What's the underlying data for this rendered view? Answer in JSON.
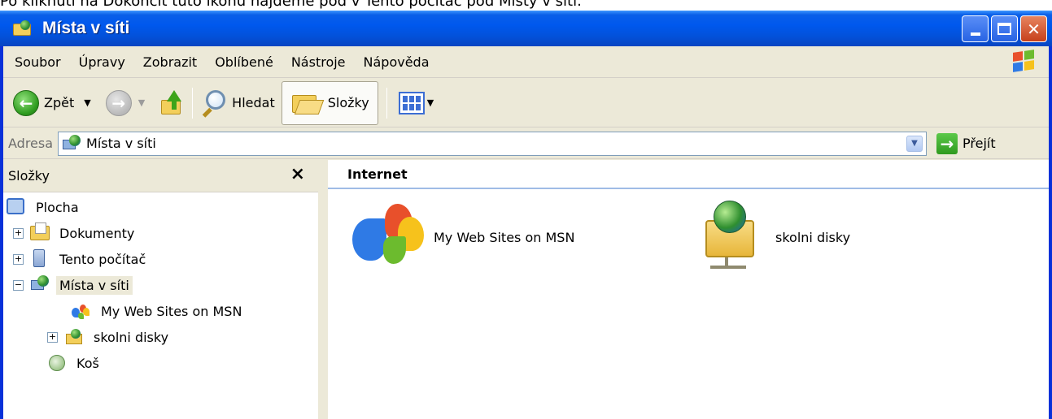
{
  "caption_text": "Po kliknutí na Dokončit tuto ikonu najdeme pod v Tento počítač pod Místy v síti.",
  "window": {
    "title": "Místa v síti",
    "icon": "network-places-icon",
    "buttons": [
      "minimize-icon",
      "maximize-icon",
      "close-icon"
    ]
  },
  "menubar": {
    "items": [
      "Soubor",
      "Úpravy",
      "Zobrazit",
      "Oblíbené",
      "Nástroje",
      "Nápověda"
    ]
  },
  "toolbar": {
    "back_label": "Zpět",
    "search_label": "Hledat",
    "folders_label": "Složky"
  },
  "addressbar": {
    "label": "Adresa",
    "value": "Místa v síti",
    "go_label": "Přejít"
  },
  "folders_pane": {
    "title": "Složky",
    "close_glyph": "×",
    "tree": [
      {
        "label": "Plocha"
      },
      {
        "label": "Dokumenty",
        "expander": "+"
      },
      {
        "label": "Tento počítač",
        "expander": "+"
      },
      {
        "label": "Místa v síti",
        "expander": "−",
        "selected": true
      },
      {
        "label": "My Web Sites on MSN"
      },
      {
        "label": "skolni disky",
        "expander": "+"
      },
      {
        "label": "Koš"
      }
    ]
  },
  "content": {
    "group_title": "Internet",
    "items": [
      {
        "label": "My Web Sites on MSN",
        "icon": "msn-butterfly-icon"
      },
      {
        "label": "skolni disky",
        "icon": "network-share-folder-icon"
      }
    ]
  },
  "colors": {
    "titlebar": "#0058ee",
    "window_border": "#0831d9",
    "chrome": "#ece9d8",
    "group_underline": "#9fbce6"
  }
}
